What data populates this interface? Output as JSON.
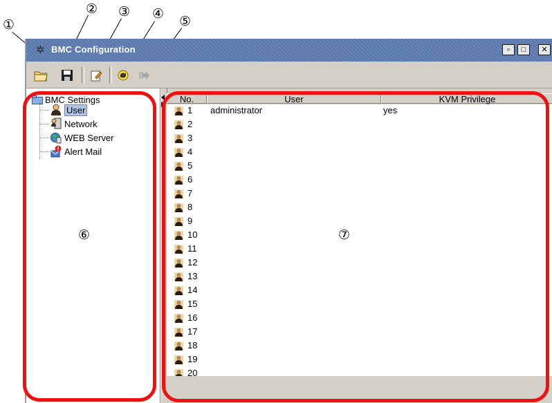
{
  "callouts": [
    "①",
    "②",
    "③",
    "④",
    "⑤",
    "⑥",
    "⑦"
  ],
  "window": {
    "title": "BMC Configuration"
  },
  "toolbar": {
    "open_icon": "folder-open-icon",
    "save_icon": "floppy-save-icon",
    "edit_icon": "edit-icon",
    "refresh_icon": "refresh-icon",
    "exit_icon": "exit-icon"
  },
  "tree": {
    "root": "BMC Settings",
    "items": [
      {
        "label": "User",
        "icon": "user-icon",
        "selected": true
      },
      {
        "label": "Network",
        "icon": "network-icon"
      },
      {
        "label": "WEB Server",
        "icon": "web-server-icon"
      },
      {
        "label": "Alert Mail",
        "icon": "alert-mail-icon"
      }
    ]
  },
  "table": {
    "columns": [
      "No.",
      "User",
      "KVM Privilege"
    ],
    "rows": [
      {
        "no": "1",
        "user": "administrator",
        "kvm": "yes"
      },
      {
        "no": "2",
        "user": "",
        "kvm": ""
      },
      {
        "no": "3",
        "user": "",
        "kvm": ""
      },
      {
        "no": "4",
        "user": "",
        "kvm": ""
      },
      {
        "no": "5",
        "user": "",
        "kvm": ""
      },
      {
        "no": "6",
        "user": "",
        "kvm": ""
      },
      {
        "no": "7",
        "user": "",
        "kvm": ""
      },
      {
        "no": "8",
        "user": "",
        "kvm": ""
      },
      {
        "no": "9",
        "user": "",
        "kvm": ""
      },
      {
        "no": "10",
        "user": "",
        "kvm": ""
      },
      {
        "no": "11",
        "user": "",
        "kvm": ""
      },
      {
        "no": "12",
        "user": "",
        "kvm": ""
      },
      {
        "no": "13",
        "user": "",
        "kvm": ""
      },
      {
        "no": "14",
        "user": "",
        "kvm": ""
      },
      {
        "no": "15",
        "user": "",
        "kvm": ""
      },
      {
        "no": "16",
        "user": "",
        "kvm": ""
      },
      {
        "no": "17",
        "user": "",
        "kvm": ""
      },
      {
        "no": "18",
        "user": "",
        "kvm": ""
      },
      {
        "no": "19",
        "user": "",
        "kvm": ""
      },
      {
        "no": "20",
        "user": "",
        "kvm": ""
      }
    ]
  },
  "colors": {
    "highlight": "#ee1111",
    "titlebar": "#5b79ad",
    "selection": "#b0c4e8"
  }
}
